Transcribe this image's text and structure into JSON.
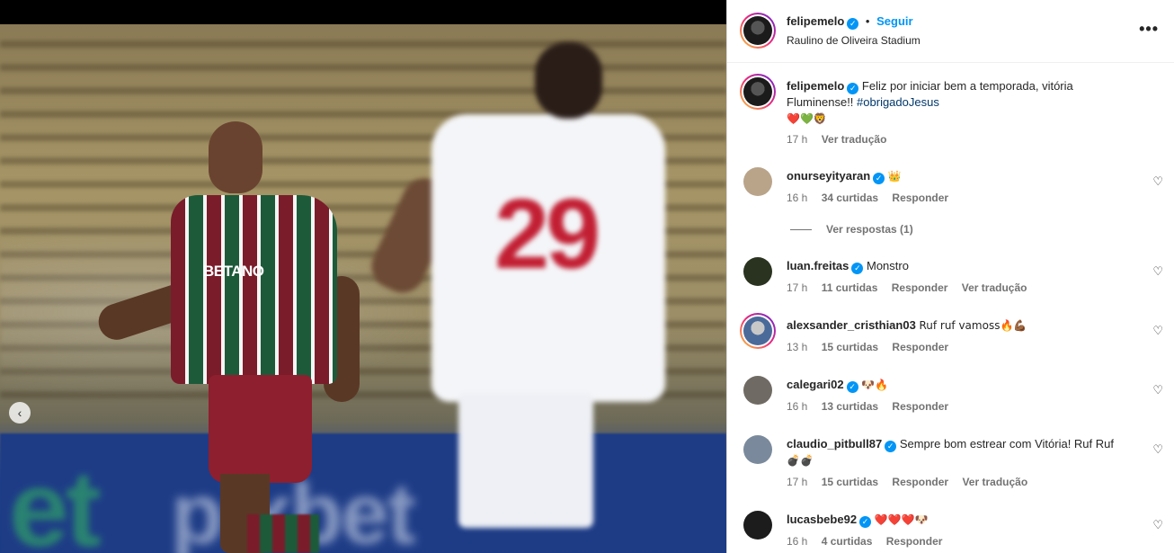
{
  "post": {
    "author": "felipemelo",
    "follow_label": "Seguir",
    "location": "Raulino de Oliveira Stadium",
    "more_label": "•••",
    "caption_user": "felipemelo",
    "caption_text": "Feliz por iniciar bem a temporada, vitória Fluminense!! ",
    "caption_hashtag": "#obrigadoJesus",
    "caption_emojis": "❤️💚🦁",
    "caption_time": "17 h",
    "caption_translate": "Ver tradução"
  },
  "photo": {
    "sponsor_text": "BETANO",
    "jersey_number": "29",
    "banner_text_left": "et",
    "banner_text_right": "pixbet"
  },
  "comments": [
    {
      "user": "onurseyityaran",
      "text": "👑",
      "time": "16 h",
      "likes": "34 curtidas",
      "reply": "Responder",
      "translate": ""
    },
    {
      "user": "luan.freitas",
      "text": "Monstro",
      "time": "17 h",
      "likes": "11 curtidas",
      "reply": "Responder",
      "translate": "Ver tradução"
    },
    {
      "user": "alexsander_cristhian03",
      "text": "Ruf ruf vamoss🔥💪🏾",
      "time": "13 h",
      "likes": "15 curtidas",
      "reply": "Responder",
      "translate": ""
    },
    {
      "user": "calegari02",
      "text": "🐶🔥",
      "time": "16 h",
      "likes": "13 curtidas",
      "reply": "Responder",
      "translate": ""
    },
    {
      "user": "claudio_pitbull87",
      "text": "Sempre bom estrear com Vitória! Ruf Ruf",
      "text2": "💣💣",
      "time": "17 h",
      "likes": "15 curtidas",
      "reply": "Responder",
      "translate": "Ver tradução"
    },
    {
      "user": "lucasbebe92",
      "text": "❤️❤️❤️🐶",
      "time": "16 h",
      "likes": "4 curtidas",
      "reply": "Responder",
      "translate": ""
    }
  ],
  "view_replies": "Ver respostas (1)",
  "colors": {
    "accent": "#0095f6",
    "text": "#262626",
    "muted": "#737373"
  }
}
